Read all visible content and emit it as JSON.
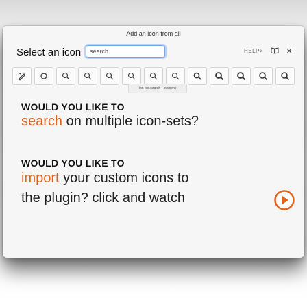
{
  "window": {
    "title": "Add an icon from all"
  },
  "header": {
    "select_label": "Select an icon",
    "search_value": "search",
    "help_text": "HELP>"
  },
  "icons": {
    "buttons": [
      {
        "name": "pencil-icon"
      },
      {
        "name": "circle-icon"
      },
      {
        "name": "search-icon-1"
      },
      {
        "name": "search-icon-2"
      },
      {
        "name": "search-icon-3"
      },
      {
        "name": "search-icon-4"
      },
      {
        "name": "search-icon-5"
      },
      {
        "name": "search-icon-6"
      },
      {
        "name": "search-icon-7"
      },
      {
        "name": "search-icon-8"
      },
      {
        "name": "search-icon-9"
      },
      {
        "name": "search-icon-10"
      },
      {
        "name": "search-icon-11"
      }
    ],
    "tooltip": "ion-ios-search · Ionicons"
  },
  "content": {
    "heading1": "WOULD YOU LIKE TO",
    "line1_accent": "search",
    "line1_rest": " on multiple icon-sets?",
    "heading2": "WOULD YOU LIKE TO",
    "line2_accent": "import",
    "line2_rest": " your custom icons to",
    "line3": "the plugin? click and watch"
  },
  "colors": {
    "accent": "#e0621c",
    "input_focus": "#7aa7e0"
  }
}
